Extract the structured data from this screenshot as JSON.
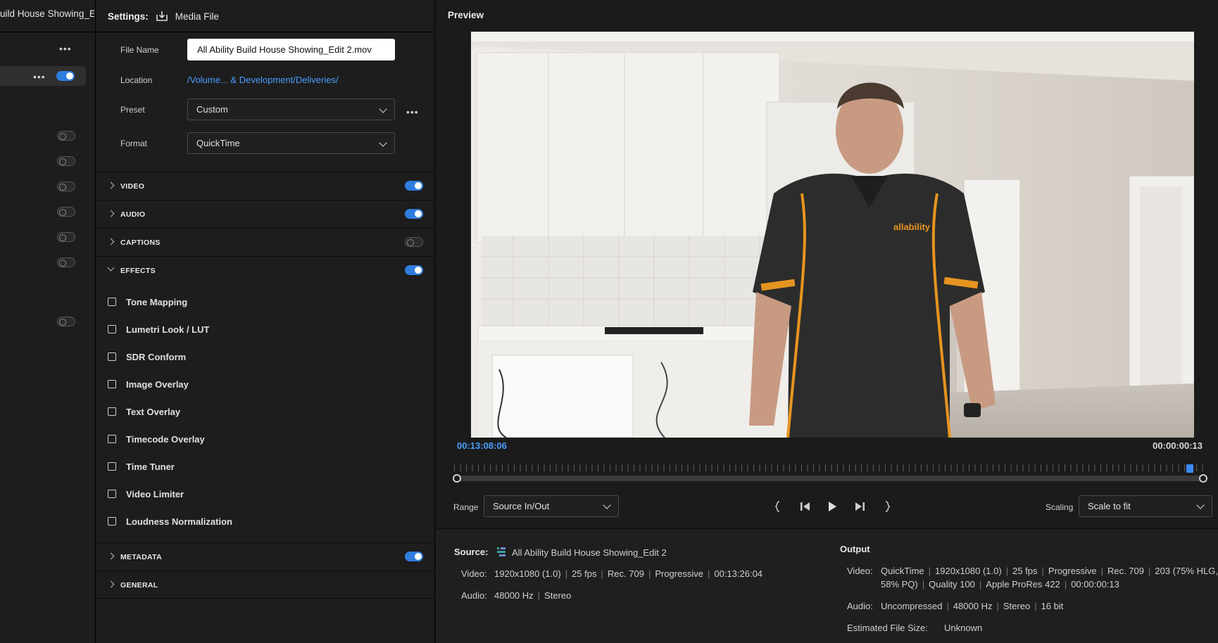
{
  "queue": {
    "title": "uild House Showing_E..."
  },
  "settings": {
    "label": "Settings:",
    "media_file": "Media File",
    "file_name_label": "File Name",
    "file_name_value": "All Ability Build House Showing_Edit 2.mov",
    "location_label": "Location",
    "location_value": "/Volume... & Development/Deliveries/",
    "preset_label": "Preset",
    "preset_value": "Custom",
    "format_label": "Format",
    "format_value": "QuickTime",
    "sections": {
      "video": "VIDEO",
      "audio": "AUDIO",
      "captions": "CAPTIONS",
      "effects": "EFFECTS",
      "metadata": "METADATA",
      "general": "GENERAL"
    },
    "effects": [
      "Tone Mapping",
      "Lumetri Look / LUT",
      "SDR Conform",
      "Image Overlay",
      "Text Overlay",
      "Timecode Overlay",
      "Time Tuner",
      "Video Limiter",
      "Loudness Normalization"
    ]
  },
  "preview": {
    "title": "Preview",
    "timecode_current": "00:13:08:06",
    "timecode_duration": "00:00:00:13",
    "range_label": "Range",
    "range_value": "Source In/Out",
    "scaling_label": "Scaling",
    "scaling_value": "Scale to fit",
    "logo_text": "allability"
  },
  "source": {
    "label": "Source:",
    "name": "All Ability Build House Showing_Edit 2",
    "video_label": "Video:",
    "video": [
      "1920x1080 (1.0)",
      "25 fps",
      "Rec. 709",
      "Progressive",
      "00:13:26:04"
    ],
    "audio_label": "Audio:",
    "audio": [
      "48000 Hz",
      "Stereo"
    ]
  },
  "output": {
    "label": "Output",
    "video_label": "Video:",
    "video_line1": [
      "QuickTime",
      "1920x1080 (1.0)",
      "25 fps",
      "Progressive",
      "Rec. 709",
      "203 (75% HLG,"
    ],
    "video_line2": [
      "58% PQ)",
      "Quality 100",
      "Apple ProRes 422",
      "00:00:00:13"
    ],
    "audio_label": "Audio:",
    "audio": [
      "Uncompressed",
      "48000 Hz",
      "Stereo",
      "16 bit"
    ],
    "size_label": "Estimated File Size:",
    "size_value": "Unknown"
  },
  "colors": {
    "accent": "#2f7ddf",
    "timecode_blue": "#4a9eff"
  }
}
